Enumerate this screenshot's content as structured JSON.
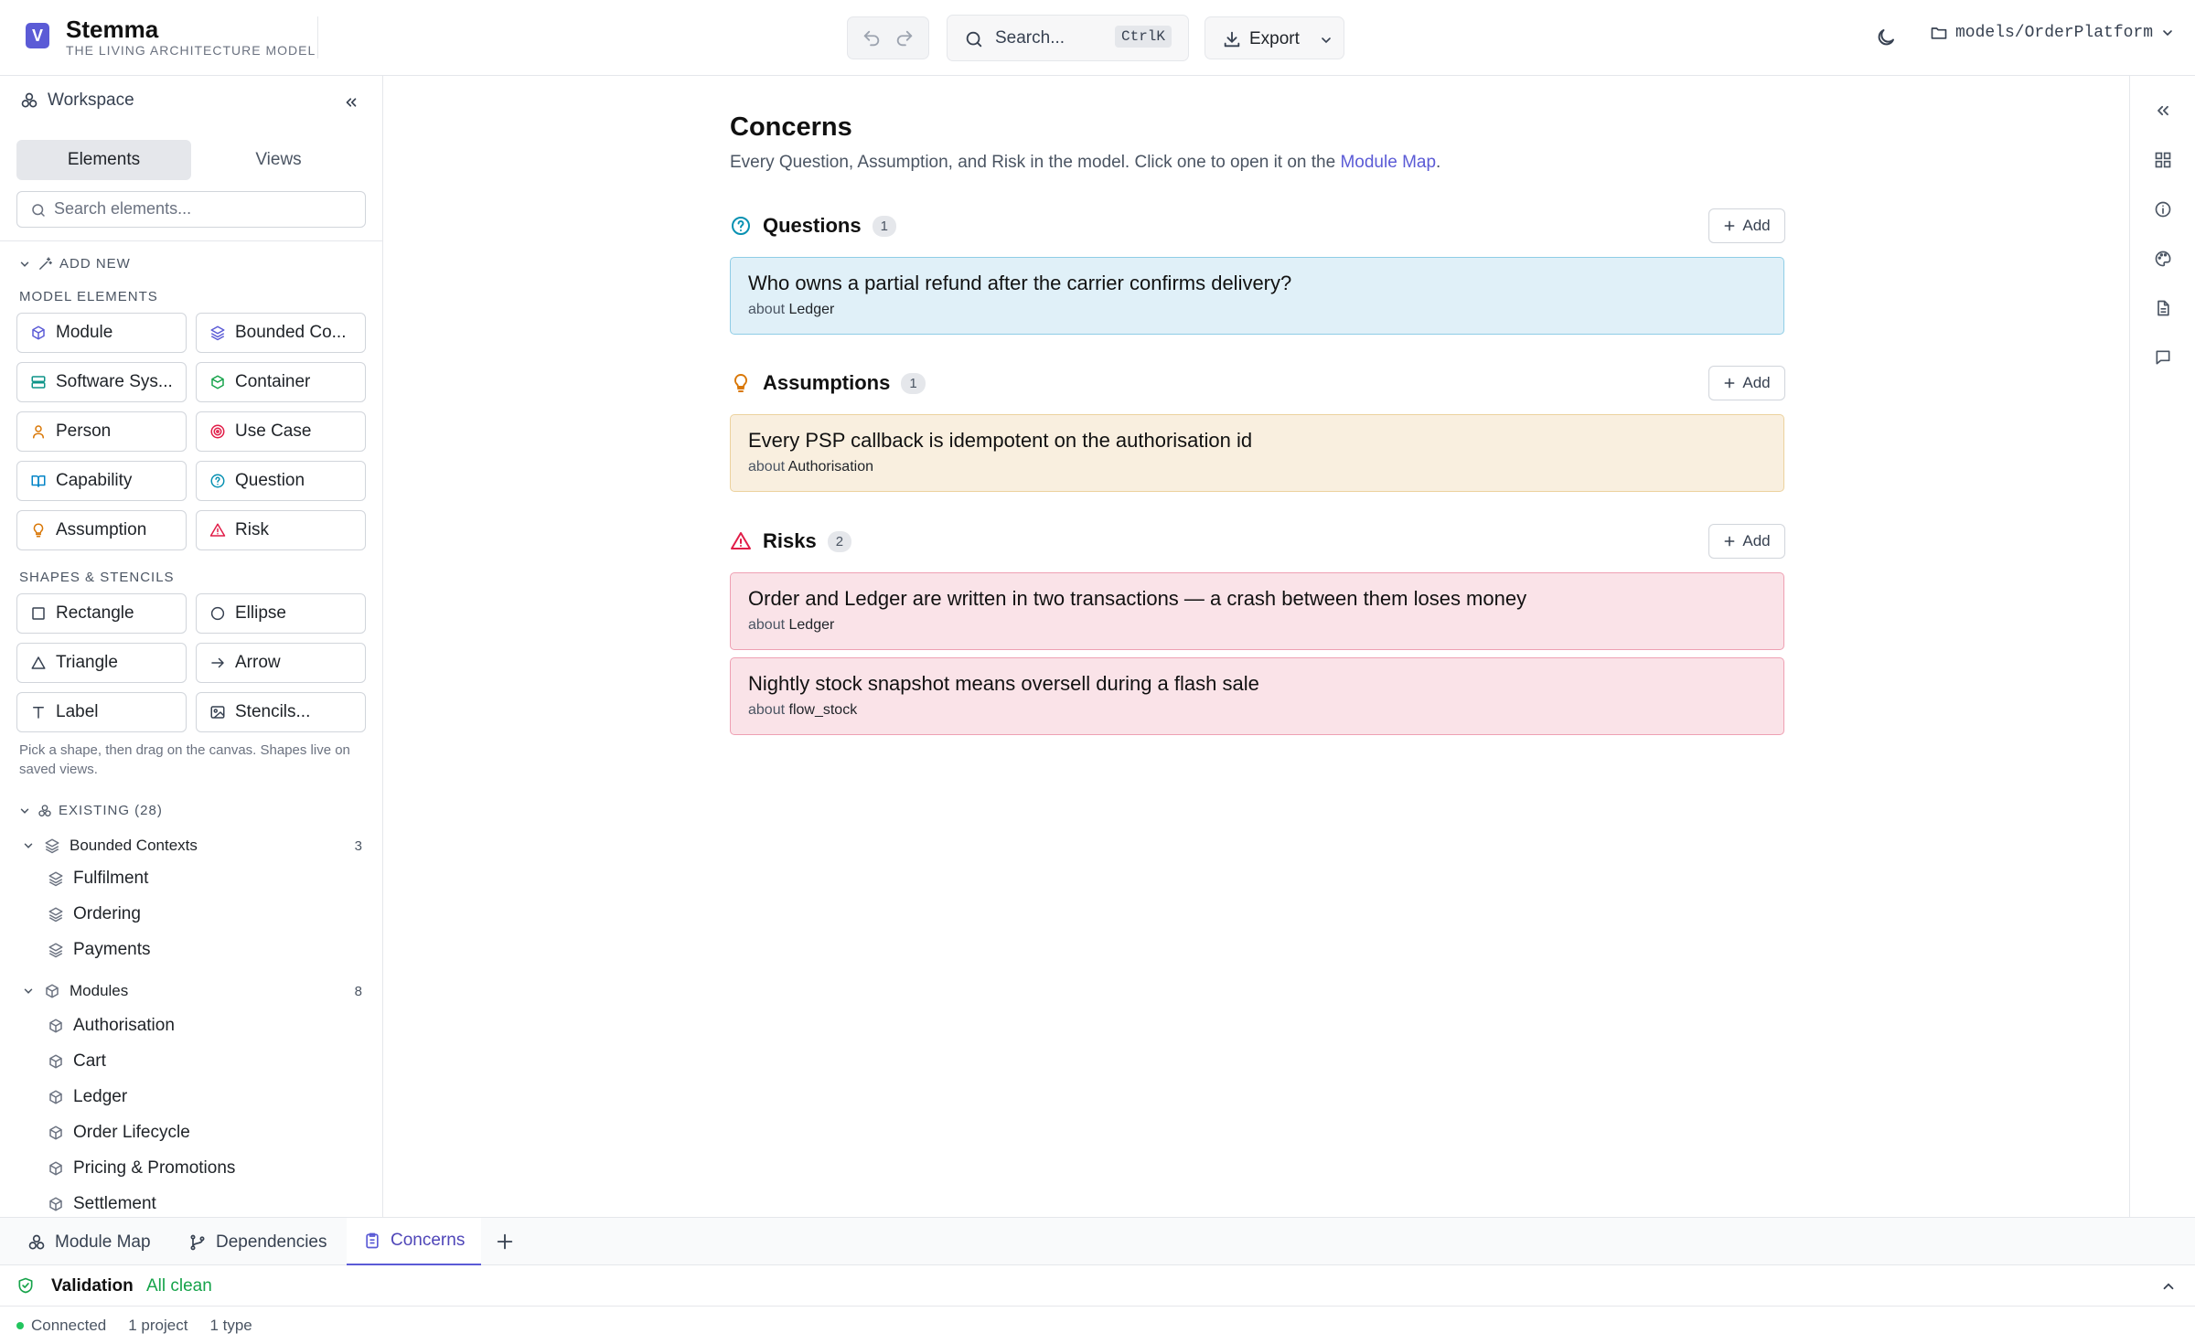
{
  "app": {
    "name": "Stemma",
    "tagline": "THE LIVING ARCHITECTURE MODEL",
    "logo_letter": "V"
  },
  "header": {
    "search_label": "Search...",
    "search_shortcut": "CtrlK",
    "export_label": "Export",
    "model_path": "models/OrderPlatform"
  },
  "sidebar": {
    "title": "Workspace",
    "tabs": [
      "Elements",
      "Views"
    ],
    "search_placeholder": "Search elements...",
    "add_new_label": "ADD NEW",
    "model_elements_title": "MODEL ELEMENTS",
    "model_elements": [
      {
        "label": "Module",
        "icon": "module-icon",
        "color": "#5b5bd6"
      },
      {
        "label": "Bounded Co...",
        "icon": "layers-icon",
        "color": "#5b5bd6"
      },
      {
        "label": "Software Sys...",
        "icon": "server-icon",
        "color": "#0d9488"
      },
      {
        "label": "Container",
        "icon": "container-icon",
        "color": "#16a34a"
      },
      {
        "label": "Person",
        "icon": "person-icon",
        "color": "#d97706"
      },
      {
        "label": "Use Case",
        "icon": "target-icon",
        "color": "#e11d48"
      },
      {
        "label": "Capability",
        "icon": "book-icon",
        "color": "#0284c7"
      },
      {
        "label": "Question",
        "icon": "question-icon",
        "color": "#0891b2"
      },
      {
        "label": "Assumption",
        "icon": "bulb-icon",
        "color": "#d97706"
      },
      {
        "label": "Risk",
        "icon": "warning-icon",
        "color": "#e11d48"
      }
    ],
    "shapes_title": "SHAPES & STENCILS",
    "shapes": [
      {
        "label": "Rectangle",
        "icon": "rectangle-icon"
      },
      {
        "label": "Ellipse",
        "icon": "ellipse-icon"
      },
      {
        "label": "Triangle",
        "icon": "triangle-icon"
      },
      {
        "label": "Arrow",
        "icon": "arrow-icon"
      },
      {
        "label": "Label",
        "icon": "text-icon"
      },
      {
        "label": "Stencils...",
        "icon": "image-icon"
      }
    ],
    "shapes_hint": "Pick a shape, then drag on the canvas. Shapes live on saved views.",
    "existing_label": "EXISTING (28)",
    "groups": [
      {
        "label": "Bounded Contexts",
        "count": "3",
        "items": [
          "Fulfilment",
          "Ordering",
          "Payments"
        ]
      },
      {
        "label": "Modules",
        "count": "8",
        "items": [
          "Authorisation",
          "Cart",
          "Ledger",
          "Order Lifecycle",
          "Pricing & Promotions",
          "Settlement"
        ]
      }
    ]
  },
  "main": {
    "title": "Concerns",
    "subtitle_prefix": "Every Question, Assumption, and Risk in the model. Click one to open it on the ",
    "subtitle_link": "Module Map",
    "subtitle_suffix": ".",
    "sections": {
      "questions": {
        "title": "Questions",
        "count": "1",
        "add_label": "Add",
        "items": [
          {
            "text": "Who owns a partial refund after the carrier confirms delivery?",
            "about_prefix": "about",
            "about": "Ledger"
          }
        ]
      },
      "assumptions": {
        "title": "Assumptions",
        "count": "1",
        "add_label": "Add",
        "items": [
          {
            "text": "Every PSP callback is idempotent on the authorisation id",
            "about_prefix": "about",
            "about": "Authorisation"
          }
        ]
      },
      "risks": {
        "title": "Risks",
        "count": "2",
        "add_label": "Add",
        "items": [
          {
            "text": "Order and Ledger are written in two transactions — a crash between them loses money",
            "about_prefix": "about",
            "about": "Ledger"
          },
          {
            "text": "Nightly stock snapshot means oversell during a flash sale",
            "about_prefix": "about",
            "about": "flow_stock"
          }
        ]
      }
    }
  },
  "right_rail": [
    "collapse-icon",
    "grid-icon",
    "info-icon",
    "palette-icon",
    "document-icon",
    "comment-icon"
  ],
  "tabs": [
    {
      "label": "Module Map",
      "icon": "map-icon",
      "active": false
    },
    {
      "label": "Dependencies",
      "icon": "branch-icon",
      "active": false
    },
    {
      "label": "Concerns",
      "icon": "clipboard-icon",
      "active": true
    }
  ],
  "validation": {
    "label": "Validation",
    "status": "All clean",
    "status_color": "#16a34a"
  },
  "status": {
    "connection": "Connected",
    "projects": "1 project",
    "types": "1 type"
  },
  "colors": {
    "accent": "#5b5bd6",
    "question_bg": "#e0f0f8",
    "assumption_bg": "#f9efdf",
    "risk_bg": "#fae3e8"
  }
}
